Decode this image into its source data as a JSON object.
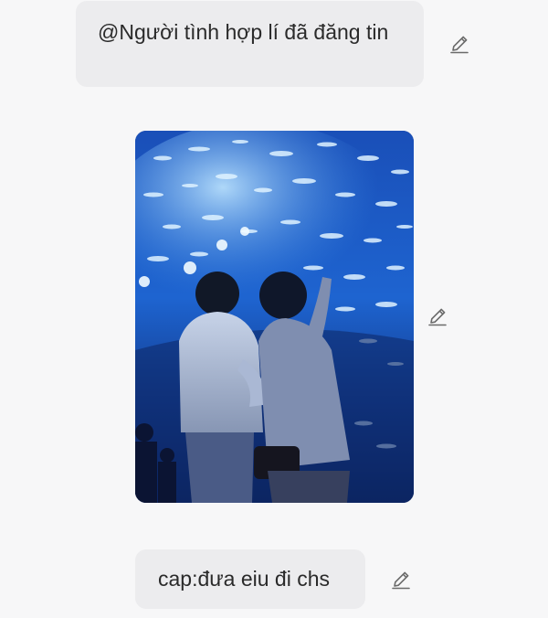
{
  "messages": {
    "top": {
      "text": "@Người tình hợp lí đã đăng tin"
    },
    "caption": {
      "text": "cap:đưa eiu đi chs"
    }
  },
  "photo": {
    "scene": "aquarium-tunnel-couple"
  },
  "icons": {
    "edit": "pencil-edit-icon"
  },
  "colors": {
    "background": "#f7f7f8",
    "bubble": "#ececee",
    "text": "#2a2a2a",
    "icon": "#6a6a6a"
  }
}
